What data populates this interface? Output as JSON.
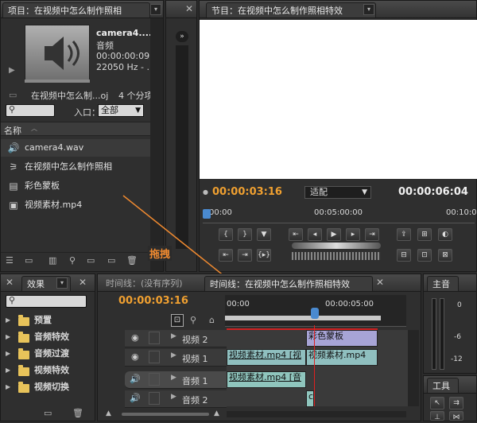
{
  "project": {
    "tab_label": "项目：在视频中怎么制作照相",
    "clip_name": "camera4....",
    "clip_type": "音频",
    "clip_duration": "00:00:00:09...",
    "clip_rate": "22050 Hz - ...",
    "project_name": "在视频中怎么制...oj",
    "item_count": "4 个分项",
    "in_label": "入口：",
    "in_value": "全部",
    "col_name": "名称",
    "items": [
      {
        "label": "camera4.wav",
        "icon": "audio-file-icon"
      },
      {
        "label": "在视频中怎么制作照相",
        "icon": "sequence-icon"
      },
      {
        "label": "彩色蒙板",
        "icon": "color-matte-icon"
      },
      {
        "label": "视频素材.mp4",
        "icon": "video-file-icon"
      }
    ]
  },
  "program": {
    "tab_label": "节目：在视频中怎么制作照相特效",
    "current_tc": "00:00:03:16",
    "fit_label": "适配",
    "duration_tc": "00:00:06:04",
    "ruler": [
      "00:00",
      "00:05:00:00",
      "00:10:0"
    ]
  },
  "annotation": {
    "drag": "拖拽"
  },
  "effects": {
    "tab_label": "效果",
    "items": [
      "预置",
      "音频特效",
      "音频过渡",
      "视频特效",
      "视频切换"
    ]
  },
  "timeline": {
    "tab1_label": "时间线：(没有序列)",
    "tab2_label": "时间线：在视频中怎么制作照相特效",
    "current_tc": "00:00:03:16",
    "ruler": [
      "00:00",
      "00:00:05:00"
    ],
    "tracks": [
      {
        "name": "视频 2"
      },
      {
        "name": "视频 1"
      },
      {
        "name": "音频 1"
      },
      {
        "name": "音频 2"
      }
    ],
    "clips": {
      "color_matte": "彩色蒙板",
      "video_a": "视频素材.mp4 [视",
      "video_b": "视频素材.mp4",
      "audio_a": "视频素材.mp4 [音"
    }
  },
  "master": {
    "label": "主音",
    "scale": [
      "0",
      "-6",
      "-12"
    ]
  },
  "tools": {
    "label": "工具"
  },
  "colors": {
    "accent": "#f0a030",
    "matte_clip": "#a7a4d6",
    "video_clip": "#8fbfbf",
    "audio_clip": "#8fc5bd",
    "playhead": "#e02020"
  }
}
